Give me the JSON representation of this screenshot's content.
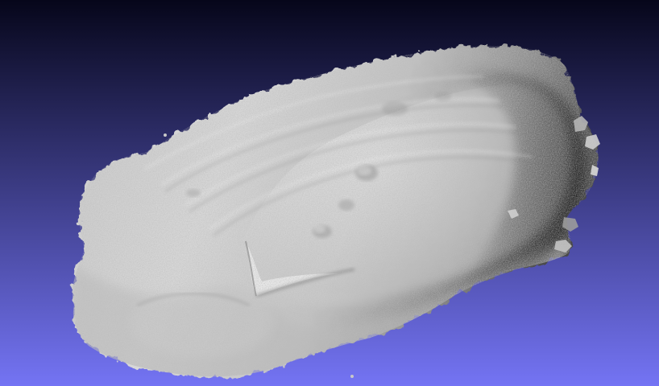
{
  "viewer": {
    "background_top": "#06061a",
    "background_bottom": "#7474f4",
    "mesh_light": "#dcdcdc",
    "mesh_mid": "#a8a8a8",
    "mesh_dark": "#5a5a5a"
  }
}
